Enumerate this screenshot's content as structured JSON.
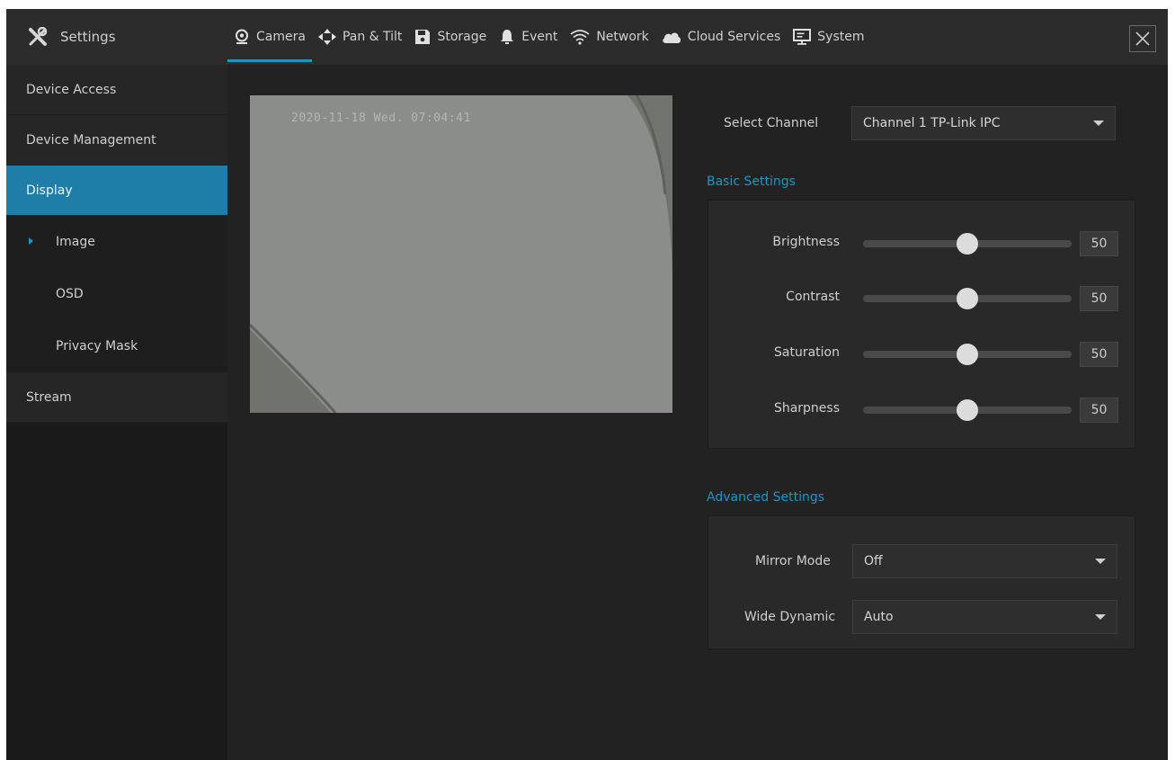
{
  "header": {
    "title": "Settings"
  },
  "tabs": [
    {
      "label": "Camera",
      "icon": "camera-icon",
      "active": true
    },
    {
      "label": "Pan & Tilt",
      "icon": "pan-tilt-icon",
      "active": false
    },
    {
      "label": "Storage",
      "icon": "storage-icon",
      "active": false
    },
    {
      "label": "Event",
      "icon": "bell-icon",
      "active": false
    },
    {
      "label": "Network",
      "icon": "wifi-icon",
      "active": false
    },
    {
      "label": "Cloud Services",
      "icon": "cloud-icon",
      "active": false
    },
    {
      "label": "System",
      "icon": "monitor-icon",
      "active": false
    }
  ],
  "sidebar": {
    "items": [
      {
        "label": "Device Access"
      },
      {
        "label": "Device Management"
      },
      {
        "label": "Display"
      },
      {
        "label": "Image"
      },
      {
        "label": "OSD"
      },
      {
        "label": "Privacy Mask"
      },
      {
        "label": "Stream"
      }
    ]
  },
  "video": {
    "timestamp": "2020-11-18 Wed. 07:04:41"
  },
  "channel": {
    "label": "Select Channel",
    "value": "Channel 1 TP-Link IPC"
  },
  "basic": {
    "title": "Basic Settings",
    "sliders": [
      {
        "label": "Brightness",
        "value": "50"
      },
      {
        "label": "Contrast",
        "value": "50"
      },
      {
        "label": "Saturation",
        "value": "50"
      },
      {
        "label": "Sharpness",
        "value": "50"
      }
    ]
  },
  "advanced": {
    "title": "Advanced Settings",
    "mirror": {
      "label": "Mirror Mode",
      "value": "Off"
    },
    "wide_dynamic": {
      "label": "Wide Dynamic",
      "value": "Auto"
    }
  },
  "colors": {
    "accent": "#1c95c7",
    "background": "#222222",
    "sidebar_active": "#1f7ea8"
  }
}
